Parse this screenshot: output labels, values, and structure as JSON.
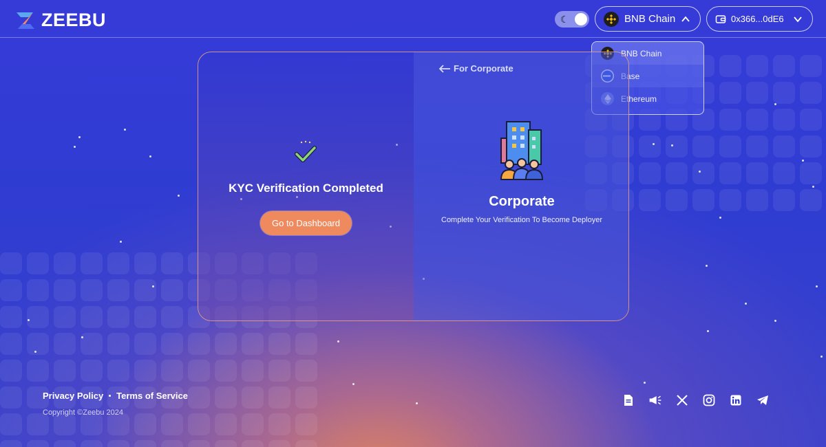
{
  "header": {
    "logo_text": "ZEEBU",
    "theme_toggle_icon": "moon-icon",
    "selected_chain": "BNB Chain",
    "wallet_address": "0x366...0dE6"
  },
  "chain_dropdown": {
    "items": [
      {
        "label": "BNB Chain",
        "icon": "bnb-chain-icon",
        "selected": true
      },
      {
        "label": "Base",
        "icon": "base-chain-icon",
        "selected": false
      },
      {
        "label": "Ethereum",
        "icon": "ethereum-icon",
        "selected": false
      }
    ]
  },
  "kyc_panel": {
    "title": "KYC Verification Completed",
    "button_label": "Go to Dashboard"
  },
  "corporate_panel": {
    "back_label": "For Corporate",
    "title": "Corporate",
    "subtitle": "Complete Your Verification To Become Deployer"
  },
  "footer": {
    "privacy_label": "Privacy Policy",
    "terms_label": "Terms of Service",
    "copyright": "Copyright ©Zeebu 2024",
    "social_icons": [
      "document-icon",
      "megaphone-icon",
      "x-icon",
      "instagram-icon",
      "linkedin-icon",
      "telegram-icon"
    ]
  },
  "colors": {
    "primary_bg": "#2a2fd6",
    "accent_orange": "#ee8a5e",
    "card_border": "#eba082"
  }
}
